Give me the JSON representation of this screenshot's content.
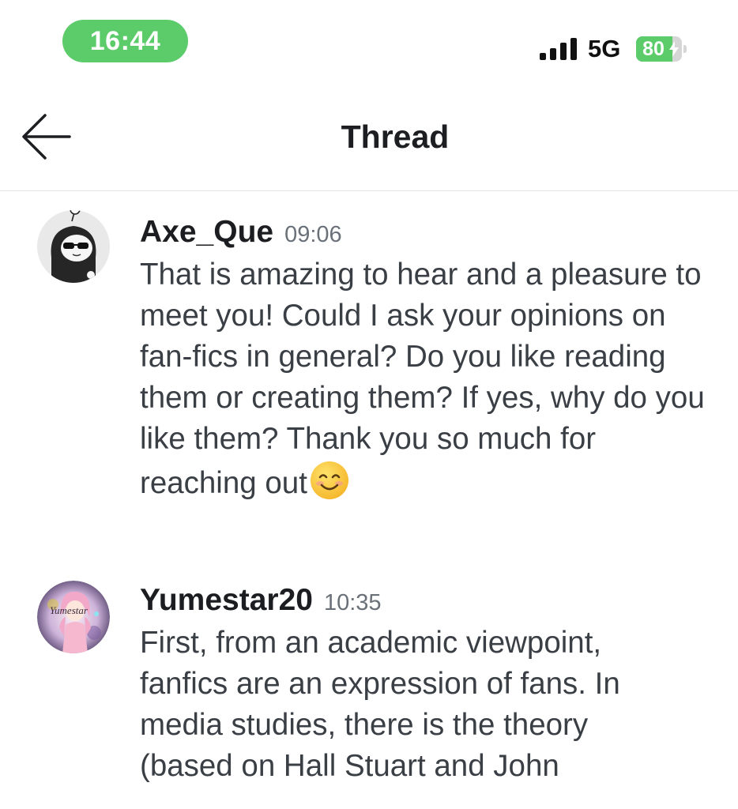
{
  "status_bar": {
    "time": "16:44",
    "network": "5G",
    "battery_level": "80",
    "battery_fraction": 0.8,
    "colors": {
      "accent_green": "#5ccb6a"
    }
  },
  "header": {
    "back_icon": "arrow-left-icon",
    "title": "Thread"
  },
  "messages": [
    {
      "author": "Axe_Que",
      "time": "09:06",
      "avatar_icon": "hooded-figure-sunglasses-avatar",
      "text": "That is amazing to hear and a pleasure to meet you! Could I ask your opinions on fan-fics in general? Do you like reading them or creating them? If yes, why do you like them? Thank you so much for reaching out",
      "trailing_emoji": "smiling-face-emoji"
    },
    {
      "author": "Yumestar20",
      "time": "10:35",
      "avatar_icon": "anime-girl-avatar",
      "avatar_caption": "Yumestar",
      "text": "First, from an academic viewpoint, fanfics are an expression of fans. In media studies, there is the theory (based on Hall Stuart and John"
    }
  ]
}
